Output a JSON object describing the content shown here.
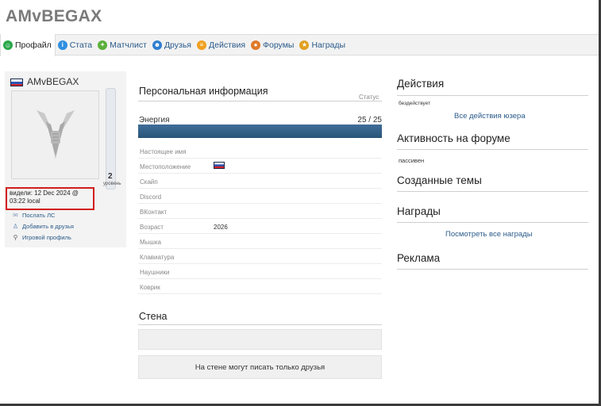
{
  "site": {
    "title": "AMvBEGAX"
  },
  "nav": [
    {
      "label": "Профайл",
      "icon": "profile-icon",
      "color": "#2aa84a",
      "active": true
    },
    {
      "label": "Стата",
      "icon": "stats-icon",
      "color": "#2f8fe0"
    },
    {
      "label": "Матчлист",
      "icon": "matchlist-icon",
      "color": "#5bb03a"
    },
    {
      "label": "Друзья",
      "icon": "friends-icon",
      "color": "#2f7fd0"
    },
    {
      "label": "Действия",
      "icon": "actions-icon",
      "color": "#f0a020"
    },
    {
      "label": "Форумы",
      "icon": "forums-icon",
      "color": "#e07a2a"
    },
    {
      "label": "Награды",
      "icon": "awards-icon",
      "color": "#e0a020"
    }
  ],
  "sidebar": {
    "username": "AMvBEGAX",
    "seen_line1": "видели: 12 Dec 2024 @",
    "seen_line2": "03:22 local",
    "level_value": "2",
    "level_label": "уровень",
    "links": [
      {
        "label": "Послать ЛС",
        "icon": "mail-icon"
      },
      {
        "label": "Добавить в друзья",
        "icon": "add-friend-icon"
      },
      {
        "label": "Игровой профиль",
        "icon": "game-profile-icon"
      }
    ]
  },
  "personal": {
    "title": "Персональная информация",
    "status_label": "Статус",
    "energy_label": "Энергия",
    "energy_value": "25 / 25",
    "energy_fraction": 1.0,
    "rows": [
      {
        "label": "Настоящее имя",
        "value": ""
      },
      {
        "label": "Местоположение",
        "value": "",
        "flag": true
      },
      {
        "label": "Скайп",
        "value": ""
      },
      {
        "label": "Discord",
        "value": ""
      },
      {
        "label": "ВКонтакт",
        "value": ""
      },
      {
        "label": "Возраст",
        "value": "2026"
      },
      {
        "label": "Мышка",
        "value": ""
      },
      {
        "label": "Клавиатура",
        "value": ""
      },
      {
        "label": "Наушники",
        "value": ""
      },
      {
        "label": "Коврик",
        "value": ""
      }
    ]
  },
  "wall": {
    "title": "Стена",
    "note": "На стене могут писать только друзья"
  },
  "right": {
    "actions_title": "Действия",
    "actions_status": "бездействует",
    "actions_link": "Все действия юзера",
    "forum_title": "Активность на форуме",
    "forum_status": "пассивен",
    "topics_title": "Созданные темы",
    "awards_title": "Награды",
    "awards_link": "Посмотреть все награды",
    "ads_title": "Реклама"
  }
}
